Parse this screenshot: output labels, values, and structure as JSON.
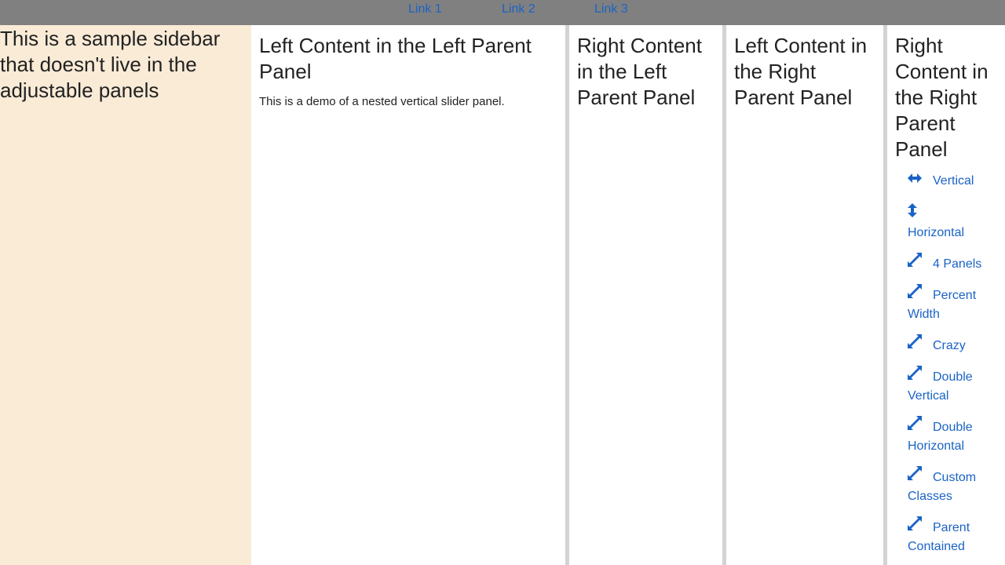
{
  "nav": {
    "link1": "Link 1",
    "link2": "Link 2",
    "link3": "Link 3"
  },
  "sidebar": {
    "text": "This is a sample sidebar that doesn't live in the adjustable panels"
  },
  "left_parent": {
    "left_title": "Left Content in the Left Parent Panel",
    "left_text": "This is a demo of a nested vertical slider panel.",
    "right_title": "Right Content in the Left Parent Panel"
  },
  "right_parent": {
    "left_title": "Left Content in the Right Parent Panel",
    "right_title": "Right Content in the Right Parent Panel"
  },
  "demos": [
    {
      "label": "Vertical",
      "icon": "arrows-horizontal-icon"
    },
    {
      "label": "Horizontal",
      "icon": "arrows-vertical-icon"
    },
    {
      "label": "4 Panels",
      "icon": "expand-icon"
    },
    {
      "label": "Percent Width",
      "icon": "expand-icon"
    },
    {
      "label": "Crazy",
      "icon": "expand-icon"
    },
    {
      "label": "Double Vertical",
      "icon": "expand-icon"
    },
    {
      "label": "Double Horizontal",
      "icon": "expand-icon"
    },
    {
      "label": "Custom Classes",
      "icon": "expand-icon"
    },
    {
      "label": "Parent Contained",
      "icon": "expand-icon"
    }
  ],
  "colors": {
    "topbar": "#808080",
    "link": "#1a63c6",
    "sidebar": "#faebd7",
    "splitter": "#d3d3d3"
  }
}
